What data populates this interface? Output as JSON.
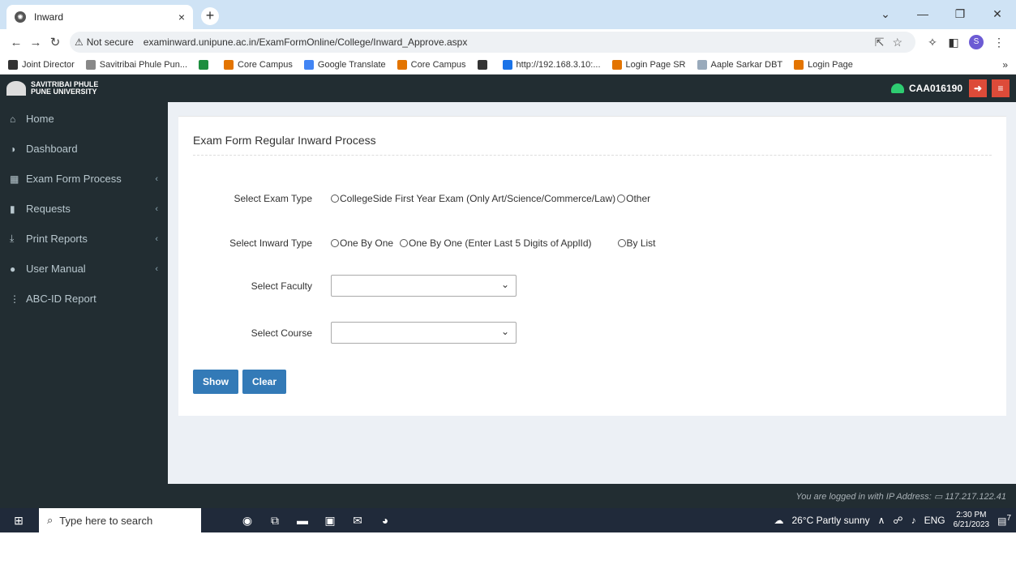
{
  "browser": {
    "tab_title": "Inward",
    "tab_close": "×",
    "new_tab": "+",
    "window_controls": [
      "⌄",
      "—",
      "❐",
      "✕"
    ],
    "not_secure": "Not secure",
    "url": "examinward.unipune.ac.in/ExamFormOnline/College/Inward_Approve.aspx",
    "profile_initial": "S",
    "bookmarks": [
      {
        "label": "Joint Director",
        "color": "#333333"
      },
      {
        "label": "Savitribai Phule Pun...",
        "color": "#888888"
      },
      {
        "label": "",
        "color": "#1e8e3e"
      },
      {
        "label": "Core Campus",
        "color": "#e37400"
      },
      {
        "label": "Google Translate",
        "color": "#4285f4"
      },
      {
        "label": "Core Campus",
        "color": "#e37400"
      },
      {
        "label": "",
        "color": "#333333"
      },
      {
        "label": "http://192.168.3.10:...",
        "color": "#1a73e8"
      },
      {
        "label": "Login Page SR",
        "color": "#e37400"
      },
      {
        "label": "Aaple Sarkar DBT",
        "color": "#9ab"
      },
      {
        "label": "Login Page",
        "color": "#e37400"
      }
    ],
    "more": "»"
  },
  "app": {
    "logo_line1": "SAVITRIBAI PHULE",
    "logo_line2": "PUNE UNIVERSITY",
    "user_id": "CAA016190"
  },
  "sidebar": {
    "items": [
      {
        "icon": "home-icon",
        "glyph": "⌂",
        "label": "Home",
        "chevron": ""
      },
      {
        "icon": "dashboard-icon",
        "glyph": "◑",
        "label": "Dashboard",
        "chevron": ""
      },
      {
        "icon": "grid-icon",
        "glyph": "▦",
        "label": "Exam Form Process",
        "chevron": "‹"
      },
      {
        "icon": "bookmark-icon",
        "glyph": "▮",
        "label": "Requests",
        "chevron": "‹"
      },
      {
        "icon": "download-icon",
        "glyph": "⤓",
        "label": "Print Reports",
        "chevron": "‹"
      },
      {
        "icon": "user-icon",
        "glyph": "●",
        "label": "User Manual",
        "chevron": "‹"
      },
      {
        "icon": "info-icon",
        "glyph": "⋮",
        "label": "ABC-ID Report",
        "chevron": ""
      }
    ]
  },
  "form": {
    "title": "Exam Form Regular Inward Process",
    "exam_type_label": "Select Exam Type",
    "exam_type_options": [
      "CollegeSide First Year Exam (Only Art/Science/Commerce/Law)",
      "Other"
    ],
    "inward_type_label": "Select Inward Type",
    "inward_type_options": [
      "One By One",
      "One By One (Enter Last 5 Digits of ApplId)",
      "By List"
    ],
    "faculty_label": "Select Faculty",
    "faculty_value": "",
    "course_label": "Select Course",
    "course_value": "",
    "show_button": "Show",
    "clear_button": "Clear"
  },
  "footer": {
    "text": "You are logged in with IP Address:",
    "ip": "117.217.122.41"
  },
  "taskbar": {
    "search_placeholder": "Type here to search",
    "weather": "26°C  Partly sunny",
    "lang": "ENG",
    "time": "2:30 PM",
    "date": "6/21/2023",
    "notif_count": "7"
  }
}
